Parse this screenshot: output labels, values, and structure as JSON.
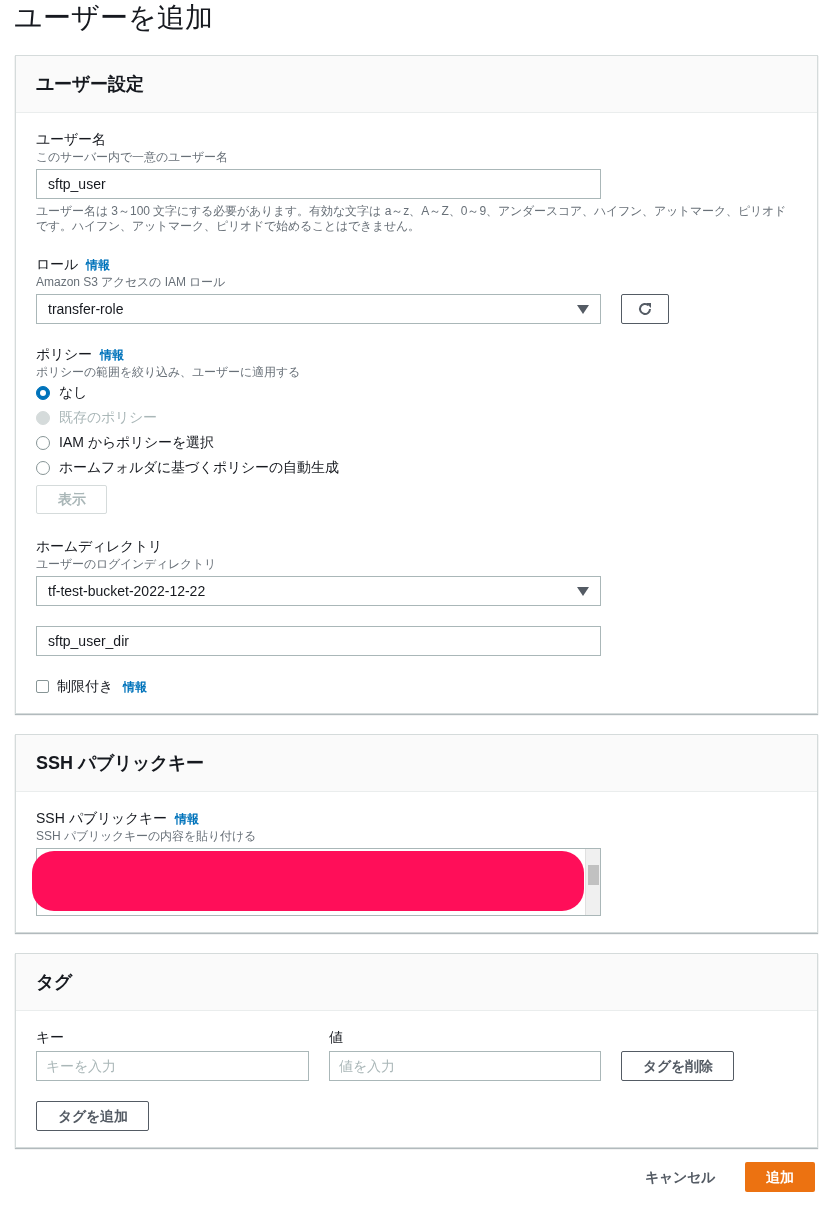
{
  "title": "ユーザーを追加",
  "user_settings": {
    "heading": "ユーザー設定",
    "username": {
      "label": "ユーザー名",
      "description": "このサーバー内で一意のユーザー名",
      "value": "sftp_user",
      "hint": "ユーザー名は 3～100 文字にする必要があります。有効な文字は a～z、A～Z、0～9、アンダースコア、ハイフン、アットマーク、ピリオドです。ハイフン、アットマーク、ピリオドで始めることはできません。"
    },
    "role": {
      "label": "ロール",
      "info": "情報",
      "description": "Amazon S3 アクセスの IAM ロール",
      "value": "transfer-role"
    },
    "policy": {
      "label": "ポリシー",
      "info": "情報",
      "description": "ポリシーの範囲を絞り込み、ユーザーに適用する",
      "options": [
        {
          "label": "なし",
          "selected": true,
          "disabled": false
        },
        {
          "label": "既存のポリシー",
          "selected": false,
          "disabled": true
        },
        {
          "label": "IAM からポリシーを選択",
          "selected": false,
          "disabled": false
        },
        {
          "label": "ホームフォルダに基づくポリシーの自動生成",
          "selected": false,
          "disabled": false
        }
      ],
      "view_button": {
        "label": "表示",
        "disabled": true
      }
    },
    "home_directory": {
      "label": "ホームディレクトリ",
      "description": "ユーザーのログインディレクトリ",
      "bucket": "tf-test-bucket-2022-12-22",
      "folder": "sftp_user_dir"
    },
    "restricted": {
      "label": "制限付き",
      "info": "情報",
      "checked": false
    }
  },
  "ssh_key": {
    "heading": "SSH パブリックキー",
    "label": "SSH パブリックキー",
    "info": "情報",
    "description": "SSH パブリックキーの内容を貼り付ける"
  },
  "tags": {
    "heading": "タグ",
    "key_label": "キー",
    "value_label": "値",
    "key_placeholder": "キーを入力",
    "value_placeholder": "値を入力",
    "remove_button": "タグを削除",
    "add_button": "タグを追加"
  },
  "footer": {
    "cancel": "キャンセル",
    "submit": "追加"
  }
}
